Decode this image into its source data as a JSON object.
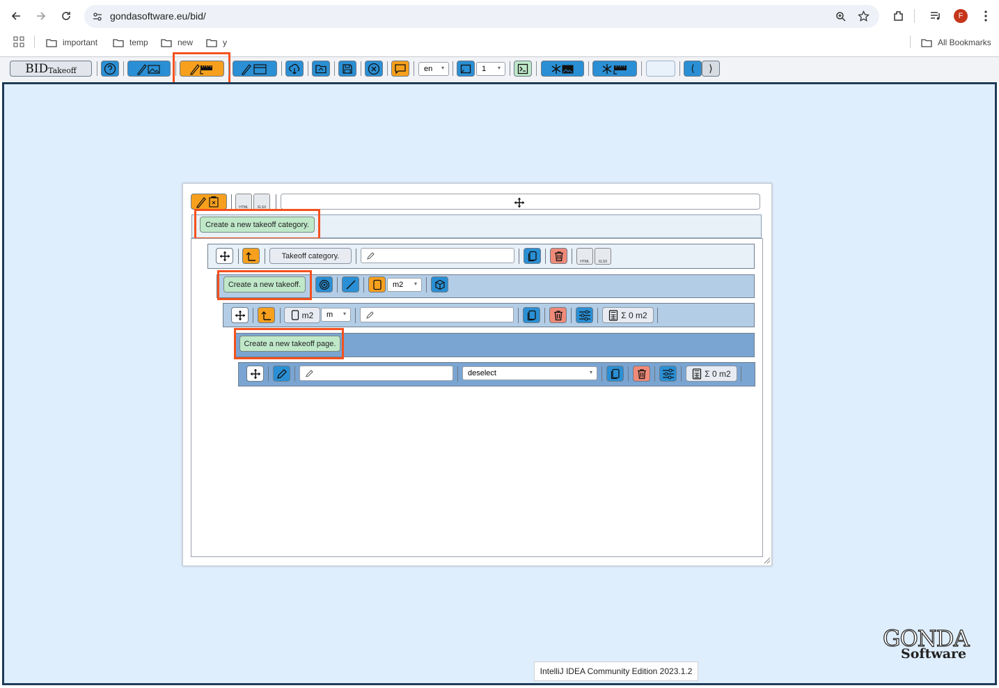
{
  "browser": {
    "url": "gondasoftware.eu/bid/",
    "profile_initial": "F",
    "bookmarks": [
      "important",
      "temp",
      "new",
      "y"
    ],
    "all_bookmarks_label": "All Bookmarks"
  },
  "toolbar": {
    "logo_main": "BID",
    "logo_sub": "Takeoff",
    "language_value": "en",
    "page_number_value": "1"
  },
  "panel": {
    "create_category_label": "Create a new takeoff category.",
    "file_html_label": "HTML",
    "file_xlsx_label": "XLSX",
    "category": {
      "name_label": "Takeoff category.",
      "name_input_value": ""
    },
    "create_takeoff_label": "Create a new takeoff.",
    "takeoff_unit_select": "m2",
    "takeoff": {
      "unit_label": "m2",
      "unit_select": "m",
      "name_input_value": "",
      "sum_label": "Σ 0 m2"
    },
    "create_page_label": "Create a new takeoff page.",
    "page": {
      "name_input_value": "",
      "selection_select": "deselect",
      "sum_label": "Σ 0 m2"
    }
  },
  "tooltip": "IntelliJ IDEA Community Edition 2023.1.2",
  "brand": {
    "line1": "GONDA",
    "line2": "Software"
  },
  "colors": {
    "accent_blue": "#2a8fd4",
    "accent_orange": "#f7a01d",
    "highlight": "#f4511e",
    "row_light": "#e8f0f8",
    "row_mid": "#b3cde6",
    "row_dark": "#7aa5d2"
  }
}
